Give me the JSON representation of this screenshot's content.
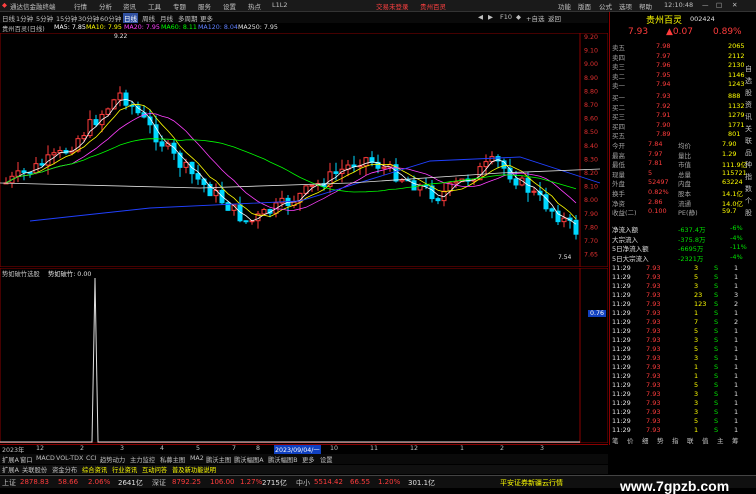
{
  "titlebar": {
    "app": "通达信金融终端",
    "menus": [
      "行情",
      "分析",
      "资讯",
      "工具",
      "专题",
      "服务",
      "设置",
      "热点",
      "L1L2"
    ],
    "promo1": "交易未登录",
    "promo2": "贵州百灵",
    "right_menus": [
      "功能",
      "版面",
      "公式",
      "选项",
      "帮助"
    ],
    "time": "12:10:48"
  },
  "periods": [
    "日线",
    "1分钟",
    "5分钟",
    "15分钟",
    "30分钟",
    "60分钟",
    "日线",
    "周线",
    "月线",
    "多周期",
    "更多"
  ],
  "tools": [
    "◀",
    "▶",
    "F10",
    "◆",
    "+自选",
    "返回"
  ],
  "legend": {
    "stock": "贵州百灵(日线)",
    "ma5": "MA5: 7.85",
    "ma10": "MA10: 7.95",
    "ma20": "MA20: 7.95",
    "ma60": "MA60: 8.11",
    "ma120": "MA120: 8.04",
    "ma250": "MA250: 7.95"
  },
  "kchart": {
    "price_axis": [
      "9.20",
      "9.10",
      "9.00",
      "8.90",
      "8.80",
      "8.70",
      "8.60",
      "8.50",
      "8.40",
      "8.30",
      "8.20",
      "8.10",
      "8.00",
      "7.90",
      "7.80",
      "7.70",
      "7.65"
    ],
    "high_label": "9.22",
    "low_label": "7.54",
    "colors": {
      "up": "#ff3c3c",
      "down": "#00d8ff",
      "ma5": "#ffffff",
      "ma10": "#ffff00",
      "ma20": "#ff40ff",
      "ma60": "#00ff00",
      "ma120": "#2040ff",
      "ma250": "#e0e0e0"
    }
  },
  "volchart": {
    "title": "势如破竹选股",
    "indicator": "势如破竹: 0.00",
    "right_value": "0.76"
  },
  "timeline": [
    "2023年",
    "12",
    "2",
    "3",
    "4",
    "5",
    "7",
    "8",
    "9",
    "10",
    "11",
    "12",
    "2023/09/04/一",
    "1",
    "2",
    "3"
  ],
  "tabs": [
    "扩展A",
    "窗口",
    "MACD",
    "VOL-TDX",
    "CCI",
    "趋势动力",
    "主力监控",
    "私募主图",
    "MA2",
    "鹏沃主图",
    "鹏沃幅图A",
    "鹏沃幅图B",
    "更多",
    "设置"
  ],
  "subtabs": [
    "扩展A",
    "关联股份",
    "资金分布",
    "综合资讯",
    "行业资讯",
    "互动问答",
    "普及新功能说明"
  ],
  "right_panel": {
    "name": "贵州百灵",
    "code": "002424",
    "price": "7.93",
    "change": "▲0.07",
    "pct": "0.89%",
    "asks": [
      {
        "label": "卖五",
        "price": "7.98",
        "vol": "2065"
      },
      {
        "label": "卖四",
        "price": "7.97",
        "vol": "2112"
      },
      {
        "label": "卖三",
        "price": "7.96",
        "vol": "2130"
      },
      {
        "label": "卖二",
        "price": "7.95",
        "vol": "1146"
      },
      {
        "label": "卖一",
        "price": "7.94",
        "vol": "1243"
      }
    ],
    "bids": [
      {
        "label": "买一",
        "price": "7.93",
        "vol": "888"
      },
      {
        "label": "买二",
        "price": "7.92",
        "vol": "1132"
      },
      {
        "label": "买三",
        "price": "7.91",
        "vol": "1279"
      },
      {
        "label": "买四",
        "price": "7.90",
        "vol": "1771"
      },
      {
        "label": "买五",
        "price": "7.89",
        "vol": "801"
      }
    ],
    "stats": [
      {
        "l1": "今开",
        "v1": "7.84",
        "l2": "均价",
        "v2": "7.90"
      },
      {
        "l1": "最高",
        "v1": "7.97",
        "l2": "量比",
        "v2": "1.29"
      },
      {
        "l1": "最低",
        "v1": "7.81",
        "l2": "市值",
        "v2": "111.9亿"
      },
      {
        "l1": "现量",
        "v1": "5",
        "l2": "总量",
        "v2": "115721"
      },
      {
        "l1": "外盘",
        "v1": "52497",
        "l2": "内盘",
        "v2": "63224"
      },
      {
        "l1": "换手",
        "v1": "0.82%",
        "l2": "股本",
        "v2": "14.1亿"
      },
      {
        "l1": "净资",
        "v1": "2.86",
        "l2": "流通",
        "v2": "14.0亿"
      },
      {
        "l1": "收益(二)",
        "v1": "0.100",
        "l2": "PE(静)",
        "v2": "59.7"
      }
    ],
    "flows": [
      {
        "label": "净流入额",
        "value": "-637.4万",
        "pct": "-6%"
      },
      {
        "label": "大宗流入",
        "value": "-375.8万",
        "pct": "-4%"
      },
      {
        "label": "5日净流入额",
        "value": "-6695万",
        "pct": "-11%"
      },
      {
        "label": "5日大宗流入",
        "value": "-2321万",
        "pct": "-4%"
      }
    ],
    "ticks": [
      {
        "t": "11:29",
        "p": "7.93",
        "v": "3",
        "s": "S",
        "n": "1"
      },
      {
        "t": "11:29",
        "p": "7.93",
        "v": "5",
        "s": "S",
        "n": "1"
      },
      {
        "t": "11:29",
        "p": "7.93",
        "v": "3",
        "s": "S",
        "n": "1"
      },
      {
        "t": "11:29",
        "p": "7.93",
        "v": "23",
        "s": "S",
        "n": "3"
      },
      {
        "t": "11:29",
        "p": "7.93",
        "v": "123",
        "s": "S",
        "n": "2"
      },
      {
        "t": "11:29",
        "p": "7.93",
        "v": "1",
        "s": "S",
        "n": "1"
      },
      {
        "t": "11:29",
        "p": "7.93",
        "v": "7",
        "s": "S",
        "n": "2"
      },
      {
        "t": "11:29",
        "p": "7.93",
        "v": "5",
        "s": "S",
        "n": "1"
      },
      {
        "t": "11:29",
        "p": "7.93",
        "v": "3",
        "s": "S",
        "n": "1"
      },
      {
        "t": "11:29",
        "p": "7.93",
        "v": "5",
        "s": "S",
        "n": "1"
      },
      {
        "t": "11:29",
        "p": "7.93",
        "v": "3",
        "s": "S",
        "n": "1"
      },
      {
        "t": "11:29",
        "p": "7.93",
        "v": "1",
        "s": "S",
        "n": "1"
      },
      {
        "t": "11:29",
        "p": "7.93",
        "v": "1",
        "s": "S",
        "n": "1"
      },
      {
        "t": "11:29",
        "p": "7.93",
        "v": "5",
        "s": "S",
        "n": "1"
      },
      {
        "t": "11:29",
        "p": "7.93",
        "v": "3",
        "s": "S",
        "n": "1"
      },
      {
        "t": "11:29",
        "p": "7.93",
        "v": "3",
        "s": "S",
        "n": "1"
      },
      {
        "t": "11:29",
        "p": "7.93",
        "v": "3",
        "s": "S",
        "n": "1"
      },
      {
        "t": "11:29",
        "p": "7.93",
        "v": "5",
        "s": "S",
        "n": "1"
      },
      {
        "t": "11:29",
        "p": "7.93",
        "v": "1",
        "s": "S",
        "n": "1"
      }
    ],
    "bottom_tabs": [
      "笔",
      "价",
      "细",
      "势",
      "指",
      "联",
      "值",
      "主",
      "筹"
    ]
  },
  "sidebar": [
    "自",
    "选",
    "股",
    "资",
    "讯",
    "关",
    "联",
    "品",
    "种",
    "指",
    "数",
    "个",
    "股"
  ],
  "statusbar": {
    "sh_label": "上证",
    "sh_val": "2878.83",
    "sh_chg": "58.66",
    "sh_pct": "2.06%",
    "sh_amt": "2641亿",
    "sz_label": "深证",
    "sz_val": "8792.25",
    "sz_chg": "106.00",
    "sz_pct": "1.27%",
    "sz_amt": "2715亿",
    "zx_label": "中小",
    "zx_val": "5514.42",
    "zx_chg": "66.55",
    "zx_pct": "1.20%",
    "zx_amt": "301.1亿",
    "broker": "平安证券新疆云行情"
  },
  "watermark": "www.7gpzb.com"
}
